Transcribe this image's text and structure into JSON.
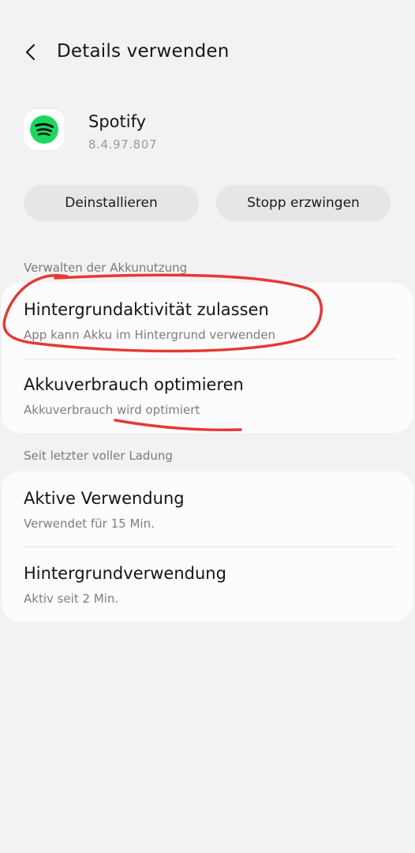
{
  "header": {
    "title": "Details verwenden"
  },
  "app": {
    "name": "Spotify",
    "version": "8.4.97.807",
    "brand_color": "#1ed760"
  },
  "actions": {
    "uninstall_label": "Deinstallieren",
    "force_stop_label": "Stopp erzwingen"
  },
  "battery_management": {
    "section_label": "Verwalten der Akkunutzung",
    "items": [
      {
        "title": "Hintergrundaktivität zulassen",
        "subtitle": "App kann Akku im Hintergrund verwenden"
      },
      {
        "title": "Akkuverbrauch optimieren",
        "subtitle": "Akkuverbrauch wird optimiert"
      }
    ]
  },
  "since_last_charge": {
    "section_label": "Seit letzter voller Ladung",
    "items": [
      {
        "title": "Aktive Verwendung",
        "subtitle": "Verwendet für 15 Min."
      },
      {
        "title": "Hintergrundverwendung",
        "subtitle": "Aktiv seit 2 Min."
      }
    ]
  },
  "colors": {
    "background": "#f2f2f2",
    "card": "#fcfcfc",
    "annotation_red": "#e53935"
  }
}
